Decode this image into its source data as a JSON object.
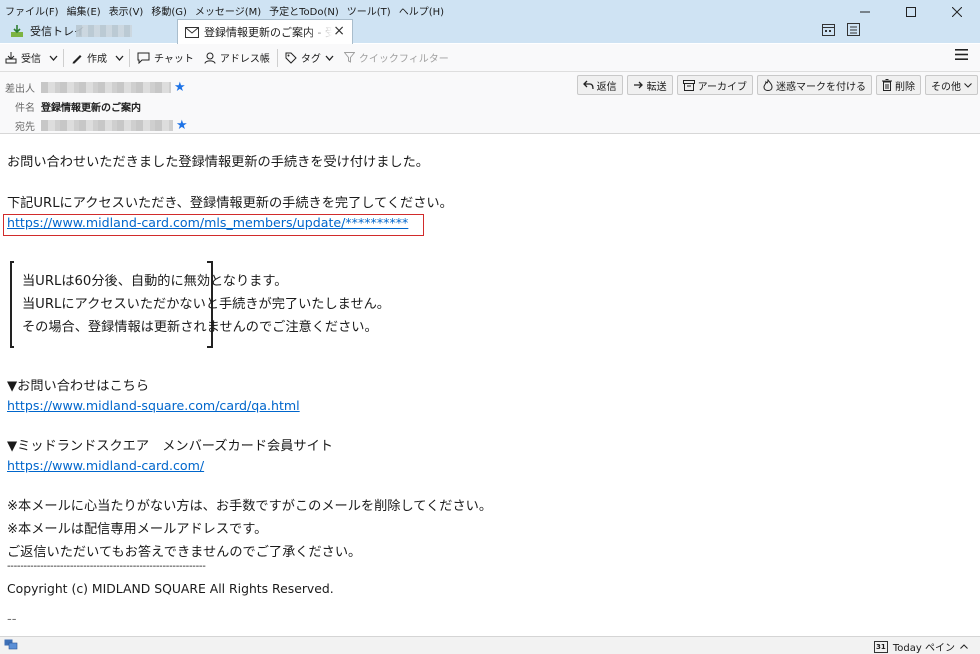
{
  "menu": [
    "ファイル(F)",
    "編集(E)",
    "表示(V)",
    "移動(G)",
    "メッセージ(M)",
    "予定とToDo(N)",
    "ツール(T)",
    "ヘルプ(H)"
  ],
  "tabs": {
    "inbox_label": "受信トレイ",
    "message_label": "登録情報更新のご案内 - 受信トレイ"
  },
  "toolbar": {
    "receive": "受信",
    "compose": "作成",
    "chat": "チャット",
    "address_book": "アドレス帳",
    "tag": "タグ",
    "quick_filter": "クイックフィルター"
  },
  "header": {
    "from_label": "差出人",
    "subject_label": "件名",
    "subject": "登録情報更新のご案内",
    "to_label": "宛先",
    "buttons": {
      "reply": "返信",
      "forward": "転送",
      "archive": "アーカイブ",
      "junk": "迷惑マークを付ける",
      "delete": "削除",
      "other": "その他"
    }
  },
  "body": {
    "line1": "お問い合わせいただきました登録情報更新の手続きを受け付けました。",
    "line2": "下記URLにアクセスいただき、登録情報更新の手続きを完了してください。",
    "update_url": "https://www.midland-card.com/mls_members/update/**********",
    "notice1": "当URLは60分後、自動的に無効となります。",
    "notice2": "当URLにアクセスいただかないと手続きが完了いたしません。",
    "notice3": "その場合、登録情報は更新されませんのでご注意ください。",
    "contact_heading": "▼お問い合わせはこちら",
    "contact_url": "https://www.midland-square.com/card/qa.html",
    "site_heading": "▼ミッドランドスクエア　メンバーズカード会員サイト",
    "site_url": "https://www.midland-card.com/",
    "footer1": "※本メールに心当たりがない方は、お手数ですがこのメールを削除してください。",
    "footer2": "※本メールは配信専用メールアドレスです。",
    "footer3": "ご返信いただいてもお答えできませんのでご了承ください。",
    "separator": "------------------------------------------------------------",
    "copyright": "Copyright (c) MIDLAND SQUARE All Rights Reserved.",
    "signature_dash": "--"
  },
  "status": {
    "today_pane": "Today ペイン",
    "calendar_day": "31"
  },
  "colors": {
    "title_bg": "#cfe3f3",
    "link": "#0066cc",
    "highlight_box": "#d12b2b",
    "star": "#1e73e6"
  }
}
